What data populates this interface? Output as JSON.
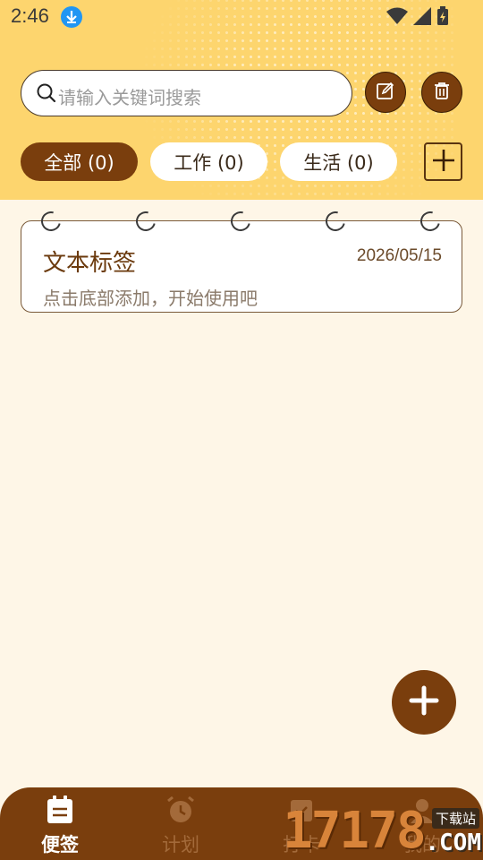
{
  "status_bar": {
    "time": "2:46"
  },
  "search": {
    "placeholder": "请输入关键词搜索"
  },
  "tabs": [
    {
      "label": "全部 (0)",
      "active": true
    },
    {
      "label": "工作 (0)",
      "active": false
    },
    {
      "label": "生活 (0)",
      "active": false
    }
  ],
  "note": {
    "title": "文本标签",
    "date": "2026/05/15",
    "body": "点击底部添加，开始使用吧"
  },
  "bottom_nav": [
    {
      "label": "便签",
      "icon": "note-icon",
      "active": true
    },
    {
      "label": "计划",
      "icon": "alarm-icon",
      "active": false
    },
    {
      "label": "打卡",
      "icon": "checkin-icon",
      "active": false
    },
    {
      "label": "我的",
      "icon": "profile-icon",
      "active": false
    }
  ],
  "watermark": {
    "digits": "17178",
    "tag": "下载站",
    "suffix": ".COM"
  },
  "colors": {
    "header": "#fdd56e",
    "accent": "#7a3e0d",
    "background": "#fef6e7"
  }
}
